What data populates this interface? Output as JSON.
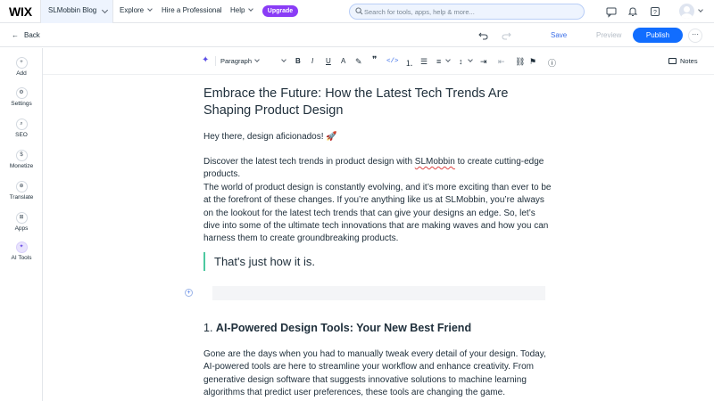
{
  "topbar": {
    "logo": "WIX",
    "site_name": "SLMobbin Blog",
    "nav": [
      {
        "label": "Explore",
        "has_chevron": true
      },
      {
        "label": "Hire a Professional",
        "has_chevron": false
      },
      {
        "label": "Help",
        "has_chevron": true
      }
    ],
    "upgrade_label": "Upgrade",
    "search_placeholder": "Search for tools, apps, help & more...",
    "icons": [
      "chat-icon",
      "bell-icon",
      "help-icon",
      "avatar"
    ]
  },
  "bar2": {
    "back_label": "Back",
    "save_label": "Save",
    "preview_label": "Preview",
    "publish_label": "Publish",
    "more_label": "···"
  },
  "sidebar": {
    "items": [
      {
        "label": "Add",
        "icon": "+"
      },
      {
        "label": "Settings",
        "icon": "⚙"
      },
      {
        "label": "SEO",
        "icon": "⌕"
      },
      {
        "label": "Monetize",
        "icon": "$"
      },
      {
        "label": "Translate",
        "icon": "⊕"
      },
      {
        "label": "Apps",
        "icon": "⊞"
      },
      {
        "label": "AI Tools",
        "icon": "✦"
      }
    ]
  },
  "toolbar": {
    "paragraph_label": "Paragraph",
    "notes_label": "Notes"
  },
  "document": {
    "title": "Embrace the Future: How the Latest Tech Trends Are Shaping Product Design",
    "greeting": "Hey there, design aficionados! 🚀",
    "intro_pre": "Discover the latest tech trends in product design with ",
    "intro_brand": "SLMobbin",
    "intro_post": " to create cutting-edge products.",
    "intro_para": "The world of product design is constantly evolving, and it’s more exciting than ever to be at the forefront of these changes. If you’re anything like us at SLMobbin, you’re always on the lookout for the latest tech trends that can give your designs an edge. So, let’s dive into some of the ultimate tech innovations that are making waves and how you can harness them to create groundbreaking products.",
    "quote": "That's just how it is.",
    "section1_number": "1.",
    "section1_title": "AI-Powered Design Tools: Your New Best Friend",
    "section1_body": "Gone are the days when you had to manually tweak every detail of your design. Today, AI-powered tools are here to streamline your workflow and enhance creativity. From generative design software that suggests innovative solutions to machine learning algorithms that predict user preferences, these tools are changing the game."
  }
}
